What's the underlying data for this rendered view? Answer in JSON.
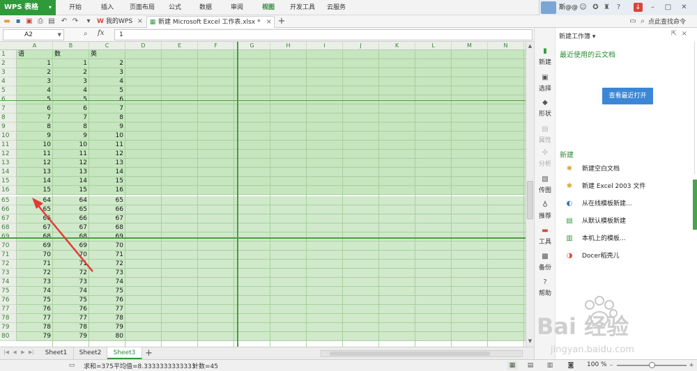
{
  "menubar": {
    "app_name": "WPS 表格",
    "items": [
      "开始",
      "插入",
      "页面布局",
      "公式",
      "数据",
      "审阅",
      "视图",
      "开发工具",
      "云服务"
    ],
    "active_item": "视图",
    "user_name": "斯@@"
  },
  "tabs": {
    "my_wps": "我的WPS",
    "doc": "新建 Microsoft Excel 工作表.xlsx *",
    "search_cmd": "点此查找命令"
  },
  "formula": {
    "name_box": "A2",
    "fx": "fx",
    "value": "1"
  },
  "grid": {
    "columns": [
      "A",
      "B",
      "C",
      "D",
      "E",
      "F",
      "G",
      "H",
      "I",
      "J",
      "K",
      "L",
      "M",
      "N"
    ],
    "header_row": {
      "row": "1",
      "a": "语",
      "b": "数",
      "c": "英"
    },
    "rows": [
      {
        "row": "2",
        "a": "1",
        "b": "1",
        "c": "2"
      },
      {
        "row": "3",
        "a": "2",
        "b": "2",
        "c": "3"
      },
      {
        "row": "4",
        "a": "3",
        "b": "3",
        "c": "4"
      },
      {
        "row": "5",
        "a": "4",
        "b": "4",
        "c": "5"
      },
      {
        "row": "6",
        "a": "5",
        "b": "5",
        "c": "6"
      },
      {
        "row": "7",
        "a": "6",
        "b": "6",
        "c": "7"
      },
      {
        "row": "8",
        "a": "7",
        "b": "7",
        "c": "8"
      },
      {
        "row": "9",
        "a": "8",
        "b": "8",
        "c": "9"
      },
      {
        "row": "10",
        "a": "9",
        "b": "9",
        "c": "10"
      },
      {
        "row": "11",
        "a": "10",
        "b": "10",
        "c": "11"
      },
      {
        "row": "12",
        "a": "11",
        "b": "11",
        "c": "12"
      },
      {
        "row": "13",
        "a": "12",
        "b": "12",
        "c": "13"
      },
      {
        "row": "14",
        "a": "13",
        "b": "13",
        "c": "14"
      },
      {
        "row": "15",
        "a": "14",
        "b": "14",
        "c": "15"
      },
      {
        "row": "16",
        "a": "15",
        "b": "15",
        "c": "16"
      },
      {
        "row": "65",
        "a": "64",
        "b": "64",
        "c": "65"
      },
      {
        "row": "66",
        "a": "65",
        "b": "65",
        "c": "66"
      },
      {
        "row": "67",
        "a": "66",
        "b": "66",
        "c": "67"
      },
      {
        "row": "68",
        "a": "67",
        "b": "67",
        "c": "68"
      },
      {
        "row": "69",
        "a": "68",
        "b": "68",
        "c": "69"
      },
      {
        "row": "70",
        "a": "69",
        "b": "69",
        "c": "70"
      },
      {
        "row": "71",
        "a": "70",
        "b": "70",
        "c": "71"
      },
      {
        "row": "72",
        "a": "71",
        "b": "71",
        "c": "72"
      },
      {
        "row": "73",
        "a": "72",
        "b": "72",
        "c": "73"
      },
      {
        "row": "74",
        "a": "73",
        "b": "73",
        "c": "74"
      },
      {
        "row": "75",
        "a": "74",
        "b": "74",
        "c": "75"
      },
      {
        "row": "76",
        "a": "75",
        "b": "75",
        "c": "76"
      },
      {
        "row": "77",
        "a": "76",
        "b": "76",
        "c": "77"
      },
      {
        "row": "78",
        "a": "77",
        "b": "77",
        "c": "78"
      },
      {
        "row": "79",
        "a": "78",
        "b": "78",
        "c": "79"
      },
      {
        "row": "80",
        "a": "79",
        "b": "79",
        "c": "80"
      }
    ]
  },
  "sheets": [
    "Sheet1",
    "Sheet2",
    "Sheet3"
  ],
  "active_sheet": "Sheet3",
  "status": {
    "sum": "求和=375",
    "avg": "平均值=8.3333333333333",
    "count": "计数=45",
    "zoom": "100 %"
  },
  "rail": [
    "新建",
    "选择",
    "形状",
    "属性",
    "分析",
    "传图",
    "推荐",
    "工具",
    "备份",
    "帮助"
  ],
  "pane": {
    "title": "新建工作簿",
    "cloud_heading": "最近使用的云文档",
    "recent_button": "查看最近打开",
    "new_heading": "新建",
    "new_items": [
      "新建空白文档",
      "新建 Excel 2003 文件",
      "从在线模板新建...",
      "从默认模板新建",
      "本机上的模板...",
      "Docer稻壳儿"
    ]
  },
  "watermark": {
    "text": "Bai 经验",
    "sub": "jingyan.baidu.com"
  },
  "colors": {
    "brand": "#2f9a3a",
    "selection": "#c6e6bf",
    "accent_blue": "#3b87d6"
  }
}
